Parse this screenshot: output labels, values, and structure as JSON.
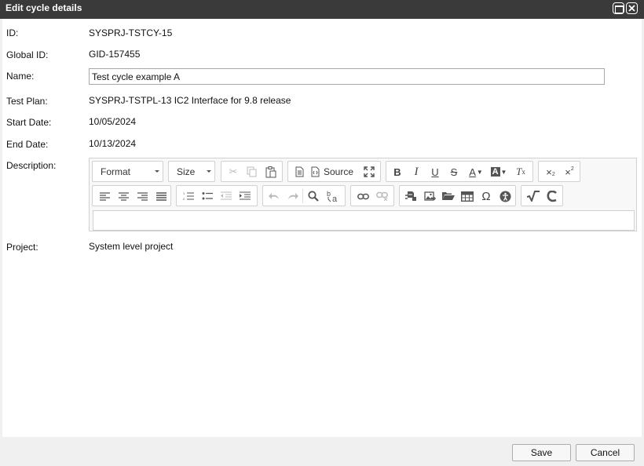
{
  "dialog": {
    "title": "Edit cycle details"
  },
  "fields": {
    "id_label": "ID:",
    "id_value": "SYSPRJ-TSTCY-15",
    "global_id_label": "Global ID:",
    "global_id_value": "GID-157455",
    "name_label": "Name:",
    "name_value": "Test cycle example A",
    "test_plan_label": "Test Plan:",
    "test_plan_value": "SYSPRJ-TSTPL-13 IC2 Interface for 9.8 release",
    "start_date_label": "Start Date:",
    "start_date_value": "10/05/2024",
    "end_date_label": "End Date:",
    "end_date_value": "10/13/2024",
    "description_label": "Description:",
    "project_label": "Project:",
    "project_value": "System level project"
  },
  "editor": {
    "format_label": "Format",
    "size_label": "Size",
    "source_label": "Source",
    "description_text": ""
  },
  "footer": {
    "save_label": "Save",
    "cancel_label": "Cancel"
  }
}
